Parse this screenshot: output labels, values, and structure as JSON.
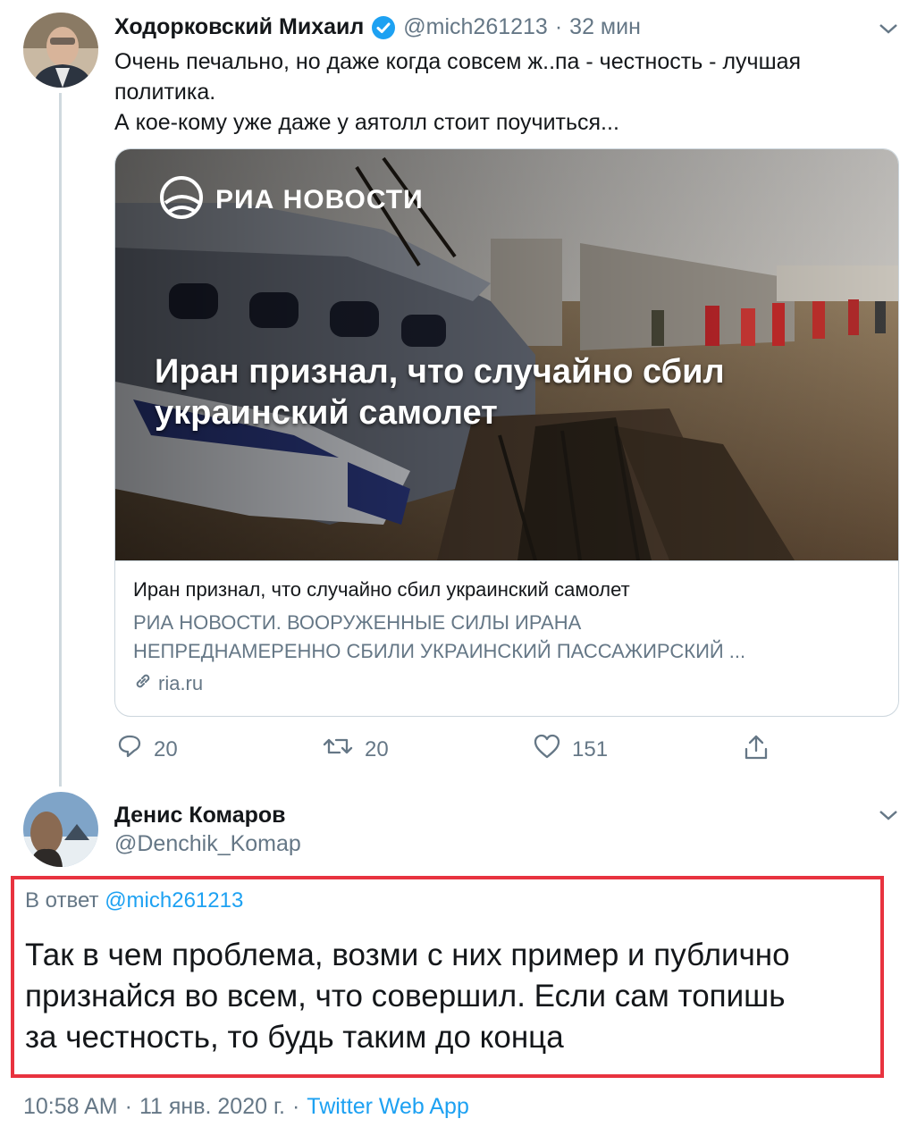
{
  "tweet1": {
    "name": "Ходорковский Михаил",
    "handle": "@mich261213",
    "separator": "·",
    "time": "32 мин",
    "text_line1": "Очень печально, но даже когда совсем ж..па - честность - лучшая",
    "text_line2": "политика.",
    "text_line3": "А кое-кому уже даже у аятолл стоит поучиться...",
    "card": {
      "logo_text": "РИА НОВОСТИ",
      "overlay_line1": "Иран признал, что случайно сбил",
      "overlay_line2": "украинский самолет",
      "title": "Иран признал, что случайно сбил украинский самолет",
      "desc_line1": "РИА НОВОСТИ. ВООРУЖЕННЫЕ СИЛЫ ИРАНА",
      "desc_line2": "НЕПРЕДНАМЕРЕННО СБИЛИ УКРАИНСКИЙ ПАССАЖИРСКИЙ ...",
      "domain": "ria.ru"
    },
    "actions": {
      "replies": "20",
      "retweets": "20",
      "likes": "151"
    }
  },
  "tweet2": {
    "name": "Денис Комаров",
    "handle": "@Denchik_Komap",
    "reply_prefix": "В ответ",
    "reply_to": "@mich261213",
    "text_line1": "Так в чем проблема, возми с них пример и публично",
    "text_line2": "признайся во всем, что совершил. Если сам топишь",
    "text_line3": "за честность, то будь таким до конца",
    "time": "10:58 AM",
    "date": "11 янв. 2020 г.",
    "sep": "·",
    "source": "Twitter Web App"
  },
  "colors": {
    "accent": "#1da1f2",
    "highlight_border": "#e8333f",
    "muted": "#657786"
  },
  "icons": [
    "verified-badge-icon",
    "chevron-down-icon",
    "reply-icon",
    "retweet-icon",
    "like-icon",
    "share-icon",
    "link-icon"
  ]
}
